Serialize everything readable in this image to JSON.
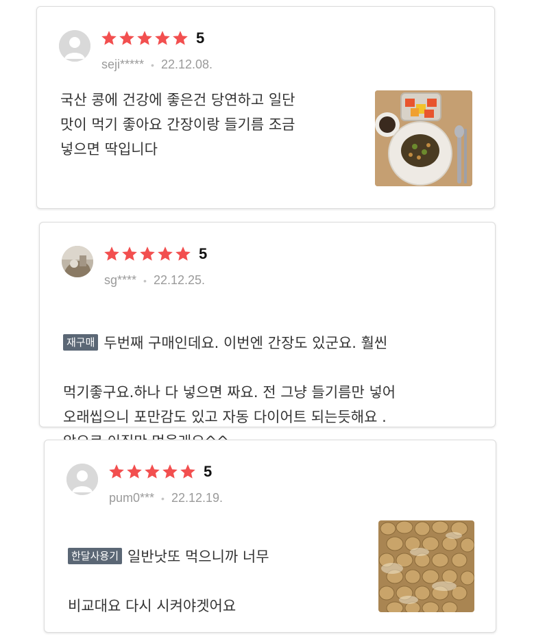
{
  "colors": {
    "star": "#f24f4f",
    "badge_bg": "#5b6775",
    "meta": "#9a9a9a"
  },
  "reviews": [
    {
      "rating": "5",
      "stars_filled": 5,
      "user": "seji*****",
      "date": "22.12.08.",
      "badge": "",
      "text": "국산 콩에 건강에 좋은건 당연하고 일단\n맛이 먹기 좋아요 간장이랑 들기름 조금\n넣으면 딱입니다",
      "photo": "natto-bowl-photo"
    },
    {
      "rating": "5",
      "stars_filled": 5,
      "user": "sg****",
      "date": "22.12.25.",
      "badge": "재구매",
      "text_first": "두번째 구매인데요. 이번엔 간장도 있군요. 훨씬",
      "text": "먹기좋구요.하나 다 넣으면 짜요. 전 그냥 들기름만 넣어\n오래씹으니 포만감도 있고 자동 다이어트 되는듯해요 .\n앞으로 이집만 먹을래요^^",
      "photo": ""
    },
    {
      "rating": "5",
      "stars_filled": 5,
      "user": "pum0***",
      "date": "22.12.19.",
      "badge": "한달사용기",
      "text_first": "일반낫또 먹으니까 너무",
      "text": "비교대요 다시 시켜야겟어요",
      "photo": "natto-closeup-photo"
    }
  ]
}
